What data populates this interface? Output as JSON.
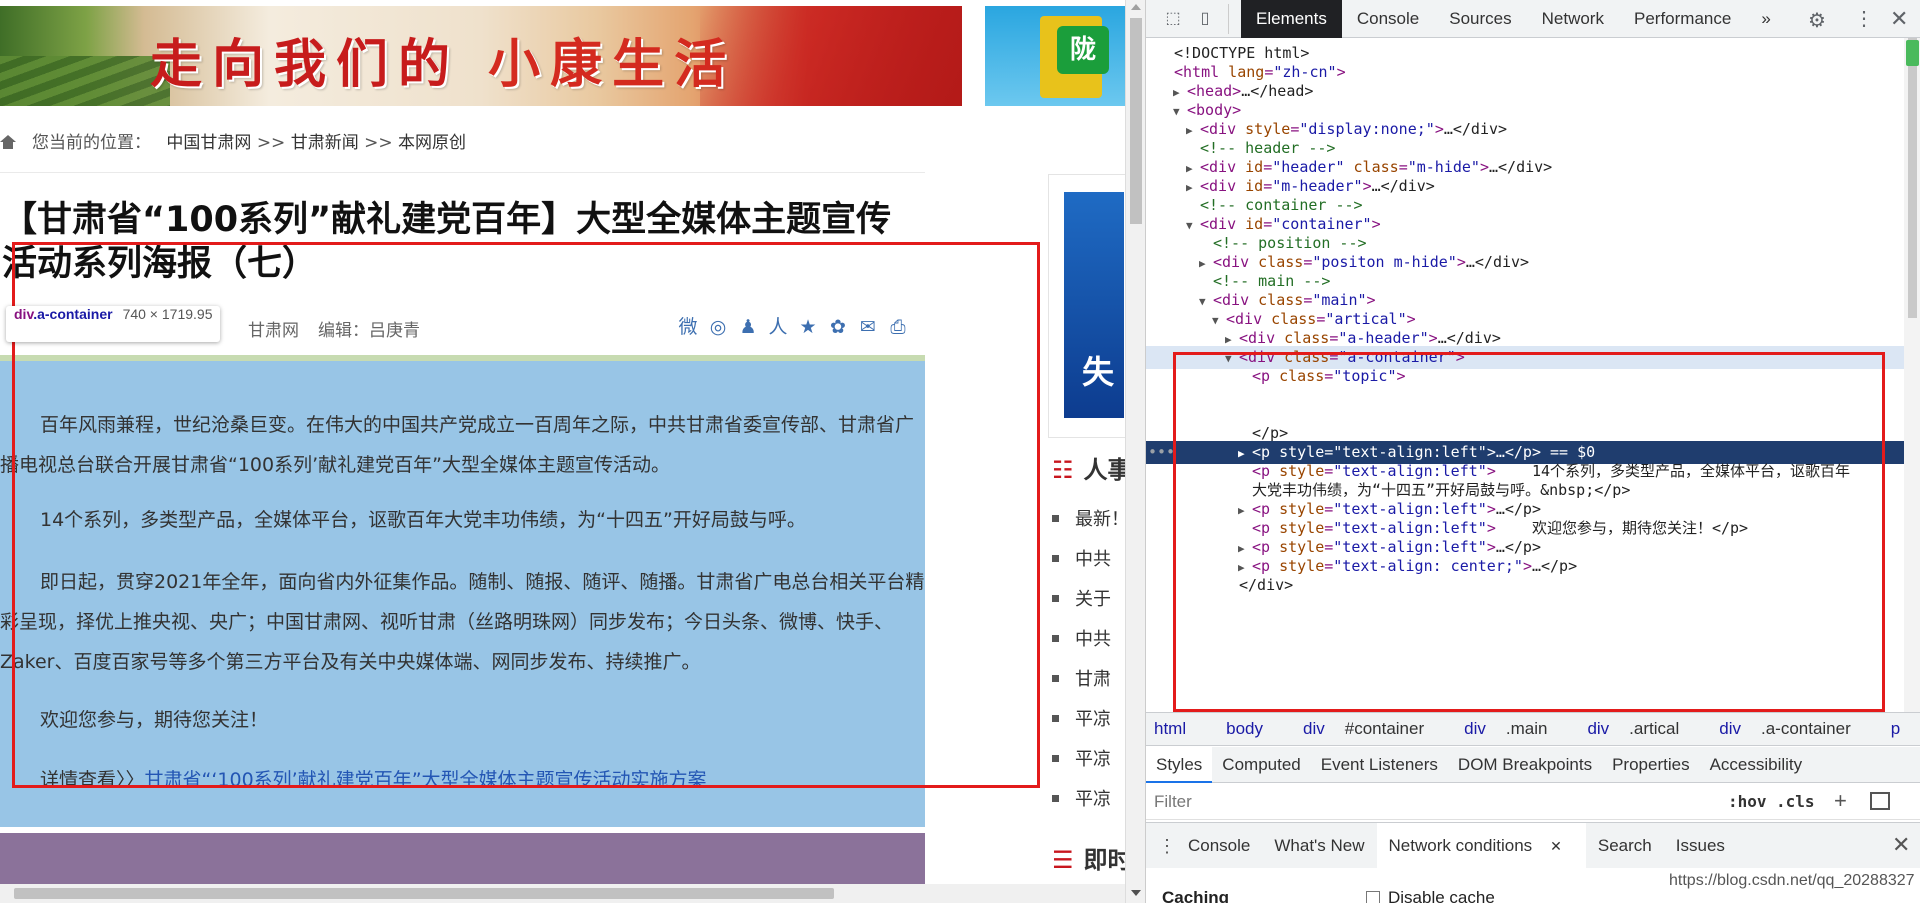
{
  "page": {
    "banner": {
      "title_a": "走向我们的",
      "title_b": "小康生活",
      "logo_text": "陇"
    },
    "breadcrumb": {
      "prefix": "您当前的位置：",
      "items": [
        "中国甘肃网",
        ">>",
        "甘肃新闻",
        ">>",
        "本网原创"
      ]
    },
    "article": {
      "title": "【甘肃省“100系列”献礼建党百年】大型全媒体主题宣传活动系列海报（七）",
      "source": "甘肃网",
      "editor": "编辑：吕庚青",
      "paragraphs": [
        "百年风雨兼程，世纪沧桑巨变。在伟大的中国共产党成立一百周年之际，中共甘肃省委宣传部、甘肃省广播电视总台联合开展甘肃省“100系列’献礼建党百年”大型全媒体主题宣传活动。",
        "14个系列，多类型产品，全媒体平台，讴歌百年大党丰功伟绩，为“十四五”开好局鼓与呼。",
        "即日起，贯穿2021年全年，面向省内外征集作品。随制、随报、随评、随播。甘肃省广电总台相关平台精彩呈现，择优上推央视、央广；中国甘肃网、视听甘肃（丝路明珠网）同步发布；今日头条、微博、快手、Zaker、百度百家号等多个第三方平台及有关中央媒体端、网同步发布、持续推广。",
        "欢迎您参与，期待您关注！"
      ],
      "more_prefix": "详情查看〉〉",
      "more_link": "甘肃省“‘100系列’献礼建党百年”大型全媒体主题宣传活动实施方案"
    },
    "share_icons": [
      "weibo-icon",
      "wechat-icon",
      "qq-icon",
      "renren-icon",
      "qzone-icon",
      "baidu-icon",
      "mail-icon",
      "print-icon"
    ],
    "share_glyphs": [
      "微",
      "◎",
      "♟",
      "人",
      "★",
      "✿",
      "✉",
      "⎙"
    ],
    "tooltip": {
      "tag": "div",
      "cls": ".a-container",
      "dims": "740 × 1719.95"
    },
    "sidebar": {
      "ad_text": "失",
      "heading1": "人事",
      "list": [
        "最新！",
        "中共",
        "关于",
        "中共",
        "甘肃",
        "平凉",
        "平凉",
        "平凉"
      ],
      "heading2": "即时"
    }
  },
  "devtools": {
    "tabs": [
      "Elements",
      "Console",
      "Sources",
      "Network",
      "Performance",
      "»"
    ],
    "active_tab": "Elements",
    "dom_lines": [
      {
        "indent": 0,
        "tri": "",
        "html": "<!DOCTYPE html>"
      },
      {
        "indent": 0,
        "tri": "",
        "open": "html",
        "attrs": [
          [
            "lang",
            "zh-cn"
          ]
        ],
        "tail": ""
      },
      {
        "indent": 1,
        "tri": "▶",
        "open": "head",
        "attrs": [],
        "tail": "…</head>"
      },
      {
        "indent": 1,
        "tri": "▼",
        "open": "body",
        "attrs": [],
        "tail": ""
      },
      {
        "indent": 2,
        "tri": "▶",
        "open": "div",
        "attrs": [
          [
            "style",
            "display:none;"
          ]
        ],
        "tail": "…</div>"
      },
      {
        "indent": 2,
        "tri": "",
        "comment": "<!-- header -->"
      },
      {
        "indent": 2,
        "tri": "▶",
        "open": "div",
        "attrs": [
          [
            "id",
            "header"
          ],
          [
            "class",
            "m-hide"
          ]
        ],
        "tail": "…</div>"
      },
      {
        "indent": 2,
        "tri": "▶",
        "open": "div",
        "attrs": [
          [
            "id",
            "m-header"
          ]
        ],
        "tail": "…</div>"
      },
      {
        "indent": 2,
        "tri": "",
        "comment": "<!-- container -->"
      },
      {
        "indent": 2,
        "tri": "▼",
        "open": "div",
        "attrs": [
          [
            "id",
            "container"
          ]
        ],
        "tail": ""
      },
      {
        "indent": 3,
        "tri": "",
        "comment": "<!-- position -->"
      },
      {
        "indent": 3,
        "tri": "▶",
        "open": "div",
        "attrs": [
          [
            "class",
            "positon m-hide"
          ]
        ],
        "tail": "…</div>"
      },
      {
        "indent": 3,
        "tri": "",
        "comment": "<!-- main -->"
      },
      {
        "indent": 3,
        "tri": "▼",
        "open": "div",
        "attrs": [
          [
            "class",
            "main"
          ]
        ],
        "tail": ""
      },
      {
        "indent": 4,
        "tri": "▼",
        "open": "div",
        "attrs": [
          [
            "class",
            "artical"
          ]
        ],
        "tail": ""
      },
      {
        "indent": 5,
        "tri": "▶",
        "open": "div",
        "attrs": [
          [
            "class",
            "a-header"
          ]
        ],
        "tail": "…</div>"
      },
      {
        "indent": 5,
        "tri": "▼",
        "open": "div",
        "attrs": [
          [
            "class",
            "a-container"
          ]
        ],
        "tail": "",
        "sel": true
      },
      {
        "indent": 6,
        "tri": "",
        "open": "p",
        "attrs": [
          [
            "class",
            "topic"
          ]
        ],
        "tail": ""
      },
      {
        "indent": 6,
        "tri": "",
        "text": ""
      },
      {
        "indent": 6,
        "tri": "",
        "text": ""
      },
      {
        "indent": 6,
        "tri": "",
        "text": "</p>"
      },
      {
        "indent": 6,
        "tri": "▶",
        "open": "p",
        "attrs": [
          [
            "style",
            "text-align:left"
          ]
        ],
        "tail": "…</p> == $0",
        "hov": true
      },
      {
        "indent": 6,
        "tri": "",
        "open": "p",
        "attrs": [
          [
            "style",
            "text-align:left"
          ]
        ],
        "tail": "    14个系列，多类型产品，全媒体平台，讴歌百年"
      },
      {
        "indent": 6,
        "tri": "",
        "text": "大党丰功伟绩，为“十四五”开好局鼓与呼。&nbsp;</p>"
      },
      {
        "indent": 6,
        "tri": "▶",
        "open": "p",
        "attrs": [
          [
            "style",
            "text-align:left"
          ]
        ],
        "tail": "…</p>"
      },
      {
        "indent": 6,
        "tri": "",
        "open": "p",
        "attrs": [
          [
            "style",
            "text-align:left"
          ]
        ],
        "tail": "    欢迎您参与，期待您关注！</p>"
      },
      {
        "indent": 6,
        "tri": "▶",
        "open": "p",
        "attrs": [
          [
            "style",
            "text-align:left"
          ]
        ],
        "tail": "…</p>"
      },
      {
        "indent": 6,
        "tri": "▶",
        "open": "p",
        "attrs": [
          [
            "style",
            "text-align: center;"
          ]
        ],
        "tail": "…</p>"
      },
      {
        "indent": 5,
        "tri": "",
        "text": "</div>"
      }
    ],
    "dom_dots": "•••",
    "breadcrumbs": [
      {
        "tag": "html",
        "rest": ""
      },
      {
        "tag": "body",
        "rest": ""
      },
      {
        "tag": "div",
        "rest": "#container"
      },
      {
        "tag": "div",
        "rest": ".main"
      },
      {
        "tag": "div",
        "rest": ".artical"
      },
      {
        "tag": "div",
        "rest": ".a-container"
      },
      {
        "tag": "p",
        "rest": ""
      }
    ],
    "styles_tabs": [
      "Styles",
      "Computed",
      "Event Listeners",
      "DOM Breakpoints",
      "Properties",
      "Accessibility"
    ],
    "styles_active": "Styles",
    "filter_placeholder": "Filter",
    "filter_hov": ":hov",
    "filter_cls": ".cls",
    "drawer_tabs": [
      "Console",
      "What's New",
      "Network conditions",
      "Search",
      "Issues"
    ],
    "drawer_active": "Network conditions",
    "caching_label": "Caching",
    "disable_cache_label": "Disable cache"
  },
  "watermark": "https://blog.csdn.net/qq_20288327",
  "colors": {
    "highlight": "#98c5e6",
    "annotation": "#e31b1b",
    "devtools_active": "#202124"
  }
}
